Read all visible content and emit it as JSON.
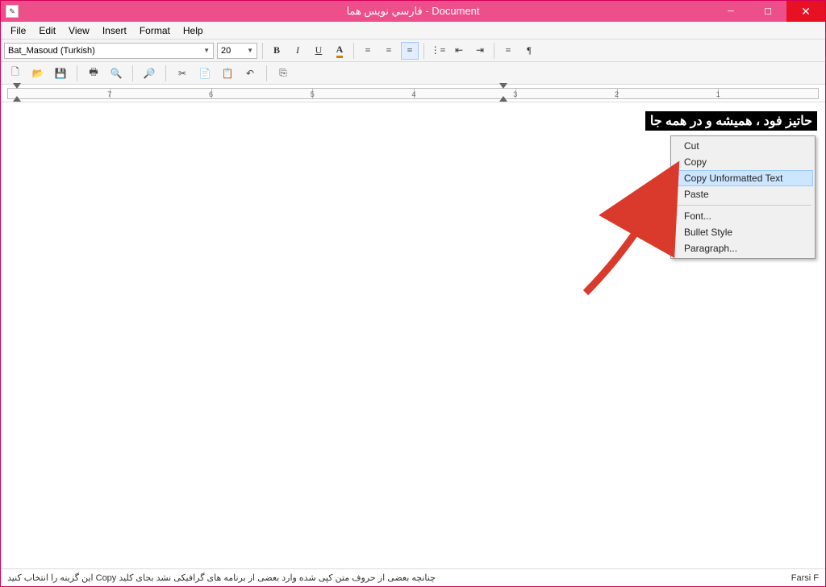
{
  "title": "فارسي نويس هما - Document",
  "menus": {
    "file": "File",
    "edit": "Edit",
    "view": "View",
    "insert": "Insert",
    "format": "Format",
    "help": "Help"
  },
  "font": {
    "name": "Bat_Masoud (Turkish)",
    "size": "20"
  },
  "fmt": {
    "bold": "B",
    "italic": "I",
    "underline": "U"
  },
  "ruler": {
    "labels": [
      "1",
      "2",
      "3",
      "4",
      "5",
      "6",
      "7"
    ]
  },
  "doc": {
    "selected_text": "حاتيز فود ، هميشه و در همه جا"
  },
  "ctx": {
    "cut": "Cut",
    "copy": "Copy",
    "copy_unfmt": "Copy Unformatted Text",
    "paste": "Paste",
    "font": "Font...",
    "bullet": "Bullet Style",
    "para": "Paragraph..."
  },
  "status": {
    "hint": "چنانچه بعضی از حروف متن کپی شده وارد بعضی از برنامه های گرافیکی نشد بجای کلید Copy این گزینه را انتخاب کنید",
    "lang": "Farsi  F"
  }
}
